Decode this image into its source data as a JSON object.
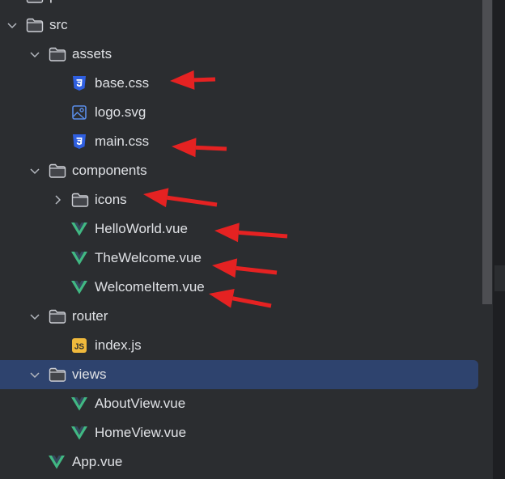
{
  "tree": [
    {
      "label": "public",
      "type": "folder",
      "depth": 0,
      "expanded": null
    },
    {
      "label": "src",
      "type": "folder",
      "depth": 0,
      "expanded": true
    },
    {
      "label": "assets",
      "type": "folder",
      "depth": 1,
      "expanded": true
    },
    {
      "label": "base.css",
      "type": "css",
      "depth": 2
    },
    {
      "label": "logo.svg",
      "type": "image",
      "depth": 2
    },
    {
      "label": "main.css",
      "type": "css",
      "depth": 2
    },
    {
      "label": "components",
      "type": "folder",
      "depth": 1,
      "expanded": true
    },
    {
      "label": "icons",
      "type": "folder",
      "depth": 2,
      "expanded": false
    },
    {
      "label": "HelloWorld.vue",
      "type": "vue",
      "depth": 2
    },
    {
      "label": "TheWelcome.vue",
      "type": "vue",
      "depth": 2
    },
    {
      "label": "WelcomeItem.vue",
      "type": "vue",
      "depth": 2
    },
    {
      "label": "router",
      "type": "folder",
      "depth": 1,
      "expanded": true
    },
    {
      "label": "index.js",
      "type": "js",
      "depth": 2
    },
    {
      "label": "views",
      "type": "folder",
      "depth": 1,
      "expanded": true,
      "selected": true
    },
    {
      "label": "AboutView.vue",
      "type": "vue",
      "depth": 2
    },
    {
      "label": "HomeView.vue",
      "type": "vue",
      "depth": 2
    },
    {
      "label": "App.vue",
      "type": "vue",
      "depth": 1
    }
  ],
  "annotations": {
    "arrow_color": "#e52222",
    "pointing_to": [
      "base.css",
      "main.css",
      "icons",
      "HelloWorld.vue",
      "TheWelcome.vue",
      "WelcomeItem.vue"
    ]
  },
  "colors": {
    "background": "#2b2d30",
    "selection": "#2e436e",
    "vue": "#41b883",
    "css": "#2f5fe0",
    "js": "#f0b93c"
  }
}
